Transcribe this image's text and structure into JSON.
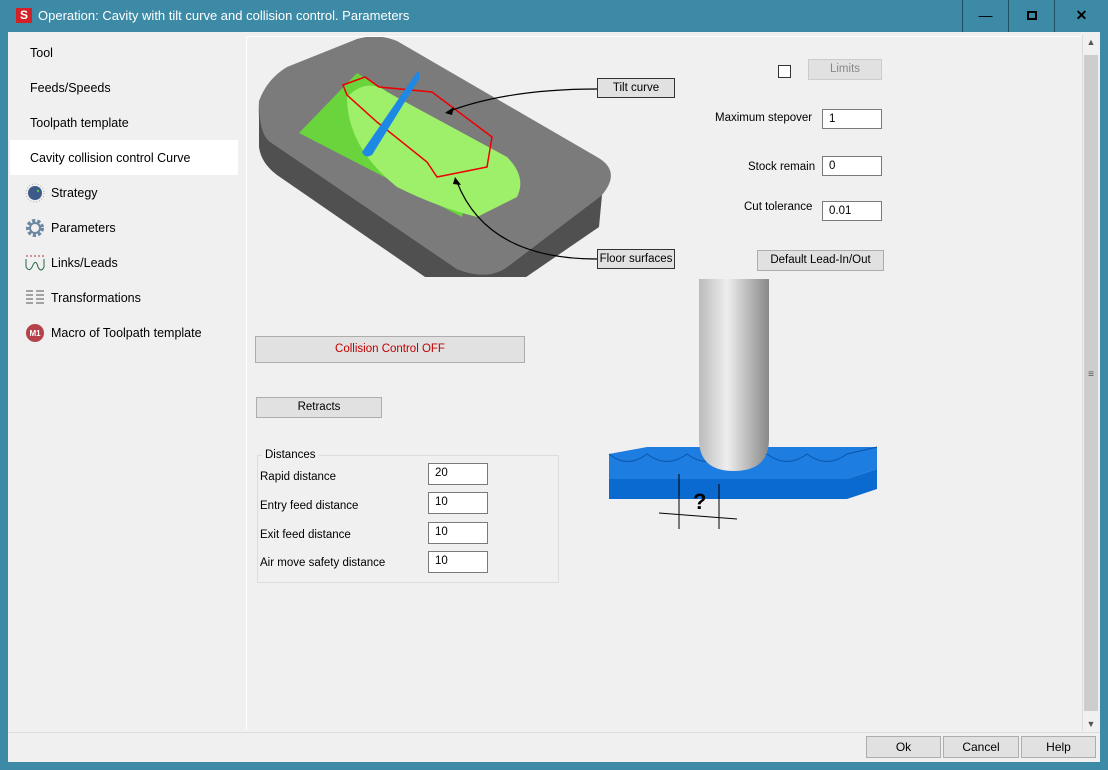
{
  "window": {
    "title": "Operation: Cavity with tilt curve and collision control. Parameters",
    "logo": "S",
    "min": "minimize-icon",
    "max": "maximize-icon",
    "close": "close-icon"
  },
  "sidebar": {
    "items": [
      {
        "label": "Tool",
        "icon": ""
      },
      {
        "label": "Feeds/Speeds",
        "icon": ""
      },
      {
        "label": "Toolpath template",
        "icon": ""
      },
      {
        "label": "Cavity collision control Curve",
        "icon": "",
        "active": true
      },
      {
        "label": "Strategy",
        "icon": "knob-icon"
      },
      {
        "label": "Parameters",
        "icon": "gear-icon"
      },
      {
        "label": "Links/Leads",
        "icon": "links-icon"
      },
      {
        "label": "Transformations",
        "icon": "transform-icon"
      },
      {
        "label": "Macro of Toolpath template",
        "icon": "macro-icon",
        "badge": "M1"
      }
    ]
  },
  "main": {
    "callouts": {
      "tilt_curve": "Tilt curve",
      "floor_surfaces": "Floor surfaces"
    },
    "limits_checked": false,
    "limits_label": "Limits",
    "max_stepover_label": "Maximum stepover",
    "max_stepover": "1",
    "stock_remain_label": "Stock remain",
    "stock_remain": "0",
    "cut_tolerance_label": "Cut tolerance",
    "cut_tolerance": "0.01",
    "default_lead_label": "Default Lead-In/Out",
    "collision_label": "Collision Control OFF",
    "collision_color": "#c00000",
    "retracts_label": "Retracts",
    "distances": {
      "legend": "Distances",
      "rows": [
        {
          "label": "Rapid distance",
          "value": "20"
        },
        {
          "label": "Entry feed distance",
          "value": "10"
        },
        {
          "label": "Exit feed distance",
          "value": "10"
        },
        {
          "label": "Air move safety distance",
          "value": "10"
        }
      ]
    },
    "stepover_question": "?"
  },
  "footer": {
    "ok": "Ok",
    "cancel": "Cancel",
    "help": "Help"
  }
}
